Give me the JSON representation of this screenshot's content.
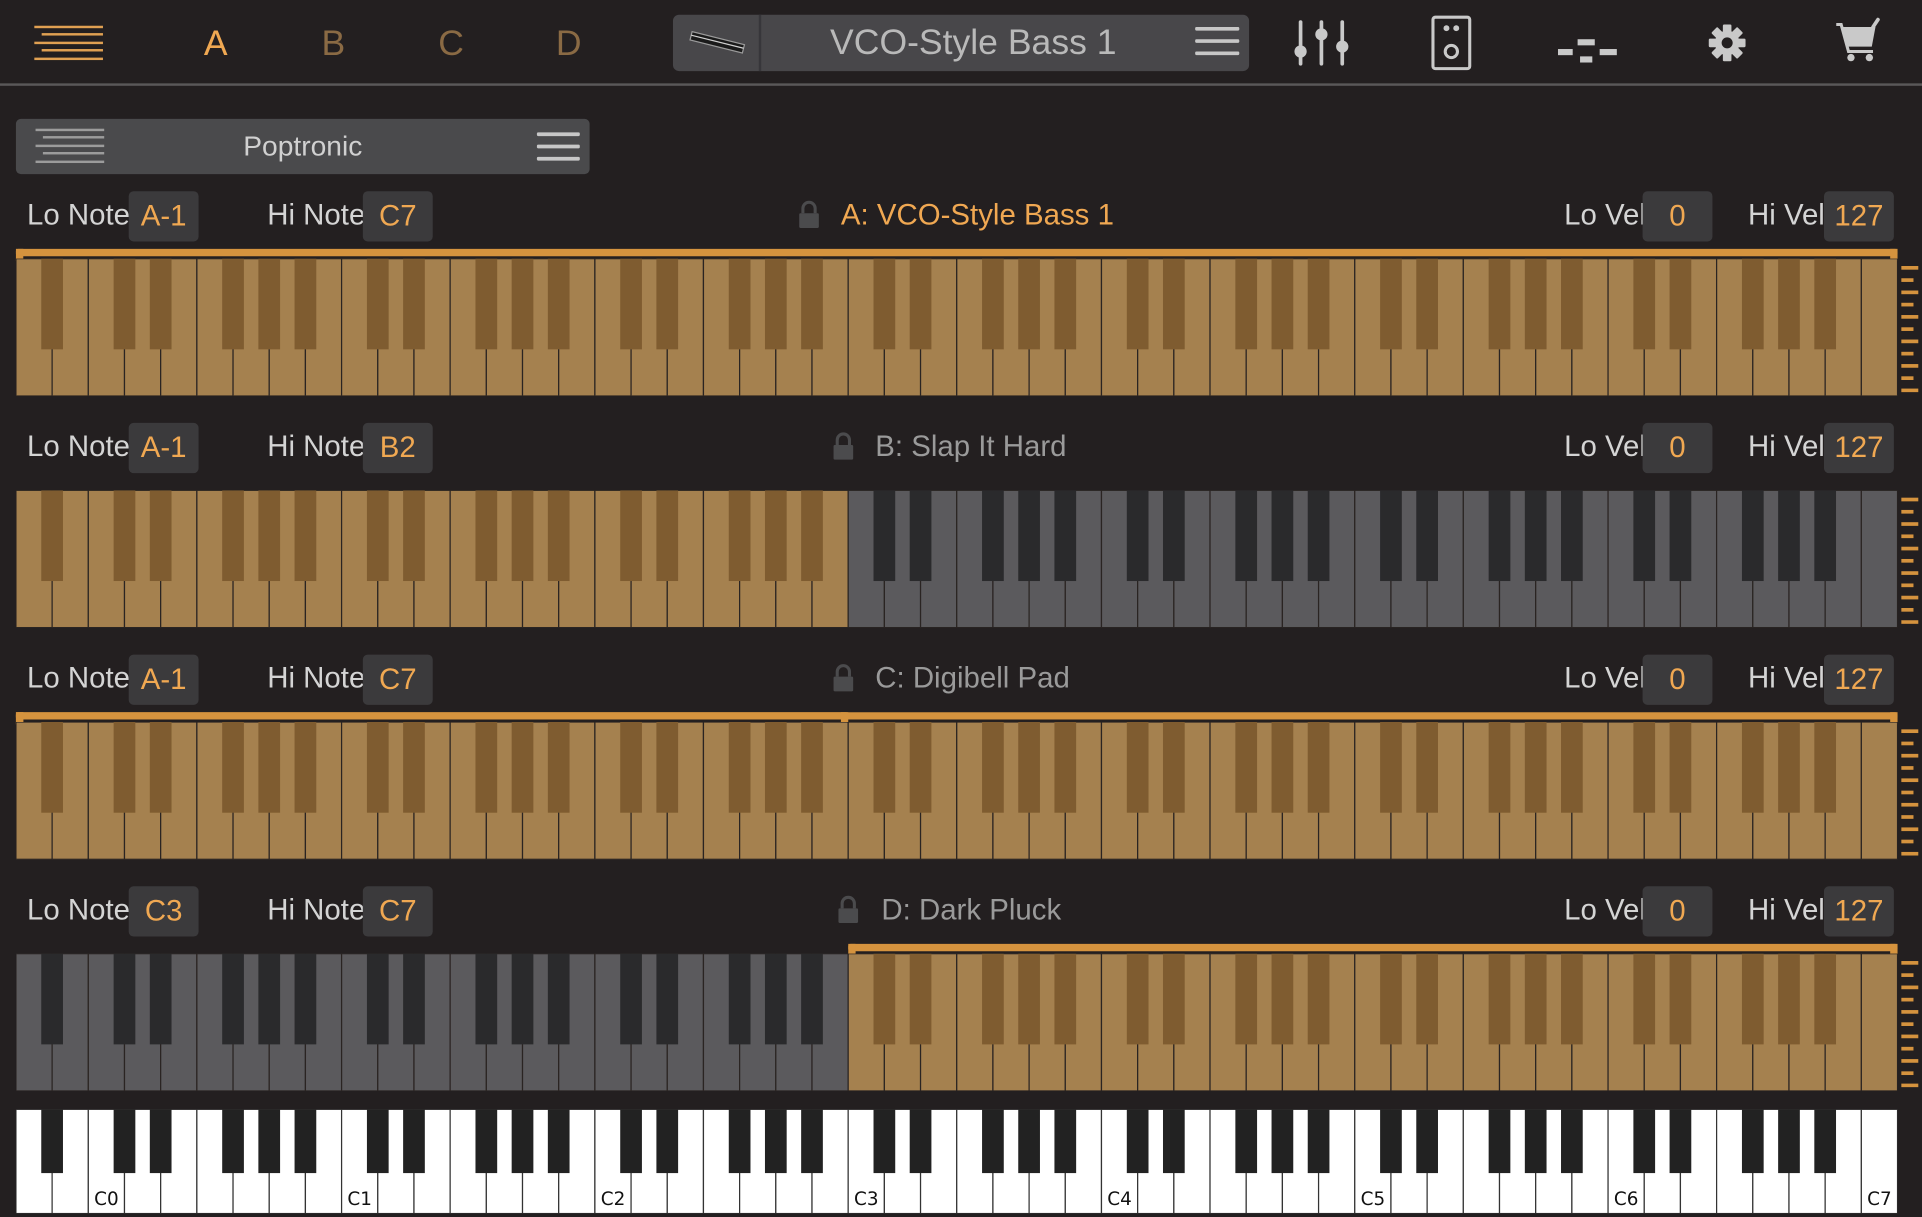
{
  "topbar": {
    "slots": [
      "A",
      "B",
      "C",
      "D"
    ],
    "active_slot": "A",
    "preset_name": "VCO-Style Bass 1",
    "icons": [
      "mixer-icon",
      "speaker-icon",
      "arpeggiator-icon",
      "gear-icon",
      "cart-icon"
    ]
  },
  "playlist": {
    "name": "Poptronic"
  },
  "labels": {
    "lo_note": "Lo Note",
    "hi_note": "Hi Note",
    "lo_vel": "Lo Vel",
    "hi_vel": "Hi Vel"
  },
  "zones": [
    {
      "name": "A: VCO-Style Bass 1",
      "lo_note": "A-1",
      "hi_note": "C7",
      "lo_vel": "0",
      "hi_vel": "127",
      "active": true
    },
    {
      "name": "B: Slap It Hard",
      "lo_note": "A-1",
      "hi_note": "B2",
      "lo_vel": "0",
      "hi_vel": "127",
      "active": false
    },
    {
      "name": "C: Digibell Pad",
      "lo_note": "A-1",
      "hi_note": "C7",
      "lo_vel": "0",
      "hi_vel": "127",
      "active": false
    },
    {
      "name": "D: Dark Pluck",
      "lo_note": "C3",
      "hi_note": "C7",
      "lo_vel": "0",
      "hi_vel": "127",
      "active": false
    }
  ],
  "keyboard": {
    "lowest_note": "A-1",
    "highest_note": "C7",
    "octave_labels": [
      "C0",
      "C1",
      "C2",
      "C3",
      "C4",
      "C5",
      "C6",
      "C7"
    ]
  },
  "colors": {
    "background": "#231f20",
    "accent": "#f0a852",
    "zone_white_key": "#a5814f",
    "zone_black_key": "#7f5c30",
    "off_white_key": "#5b5a5d",
    "off_black_key": "#2a2a2c",
    "range_bar": "#d5933e"
  }
}
